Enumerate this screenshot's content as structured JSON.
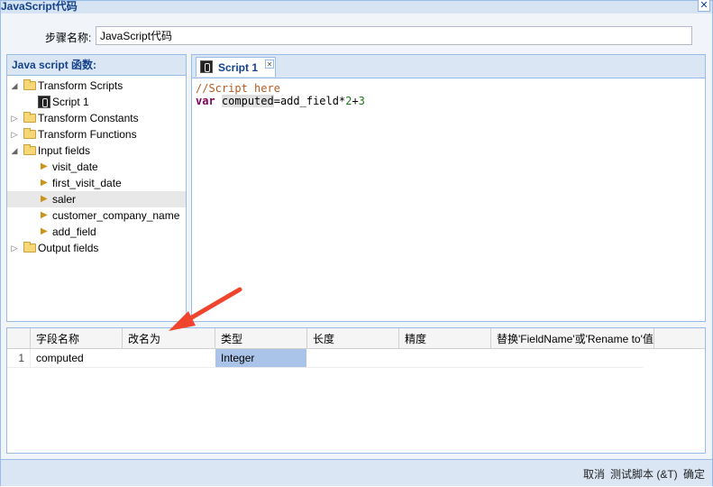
{
  "window": {
    "title": "JavaScript代码",
    "close_symbol": "✕"
  },
  "step": {
    "label": "步骤名称:",
    "value": "JavaScript代码"
  },
  "left_panel": {
    "header": "Java script 函数:",
    "tree": [
      {
        "label": "Transform Scripts"
      },
      {
        "label": "Script 1"
      },
      {
        "label": "Transform Constants"
      },
      {
        "label": "Transform Functions"
      },
      {
        "label": "Input fields"
      },
      {
        "label": "visit_date"
      },
      {
        "label": "first_visit_date"
      },
      {
        "label": "saler"
      },
      {
        "label": "customer_company_name"
      },
      {
        "label": "add_field"
      },
      {
        "label": "Output fields"
      }
    ]
  },
  "editor": {
    "tab_label": "Script 1",
    "comment": "//Script here",
    "kw": "var",
    "varname": "computed",
    "eq": "=add_field*",
    "n1": "2",
    "plus": "+",
    "n2": "3"
  },
  "grid": {
    "columns": [
      "字段名称",
      "改名为",
      "类型",
      "长度",
      "精度",
      "替换'FieldName'或'Rename to'值"
    ],
    "rows": [
      {
        "num": "1",
        "name": "computed",
        "rename": "",
        "type": "Integer",
        "length": "",
        "precision": "",
        "replace": ""
      }
    ]
  },
  "footer": {
    "cancel": "取消",
    "test": "测试脚本 (&T)",
    "ok": "确定"
  },
  "colors": {
    "accent": "#15428b",
    "panel_border": "#99bbe8",
    "selection": "#a9c4e8",
    "annotation_arrow": "#f0442c"
  }
}
